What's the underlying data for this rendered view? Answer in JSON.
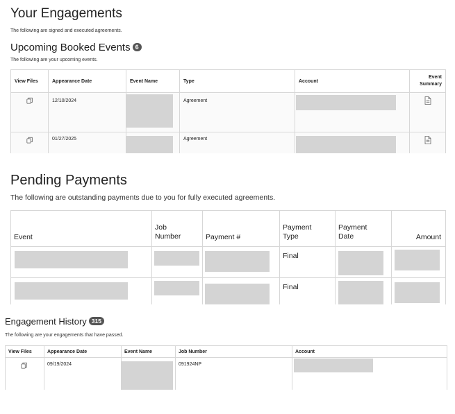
{
  "engagements": {
    "title": "Your Engagements",
    "subtitle": "The following are signed and executed agreements."
  },
  "upcoming": {
    "title": "Upcoming Booked Events",
    "count": "6",
    "subtitle": "The following are your upcoming events.",
    "headers": {
      "files": "View Files",
      "date": "Appearance Date",
      "name": "Event Name",
      "type": "Type",
      "account": "Account",
      "summary_1": "Event",
      "summary_2": "Summary"
    },
    "rows": [
      {
        "date": "12/10/2024",
        "type": "Agreement"
      },
      {
        "date": "01/27/2025",
        "type": "Agreement"
      }
    ]
  },
  "pending": {
    "title": "Pending Payments",
    "subtitle": "The following are outstanding payments due to you for fully executed agreements.",
    "headers": {
      "event": "Event",
      "job_1": "Job",
      "job_2": "Number",
      "payment_no": "Payment #",
      "ptype_1": "Payment",
      "ptype_2": "Type",
      "pdate_1": "Payment",
      "pdate_2": "Date",
      "amount": "Amount"
    },
    "rows": [
      {
        "type": "Final"
      },
      {
        "type": "Final"
      }
    ]
  },
  "history": {
    "title": "Engagement History",
    "count": "315",
    "subtitle": "The following are your engagements that have passed.",
    "headers": {
      "files": "View Files",
      "date": "Appearance Date",
      "name": "Event Name",
      "job": "Job Number",
      "account": "Account"
    },
    "rows": [
      {
        "date": "09/19/2024",
        "job": "091924NP"
      }
    ]
  },
  "colors": {
    "redacted": "#d4d4d4",
    "badge": "#555555",
    "border": "#d7d7d7"
  },
  "icons": {
    "files": "copy-files-icon",
    "summary": "document-icon"
  }
}
